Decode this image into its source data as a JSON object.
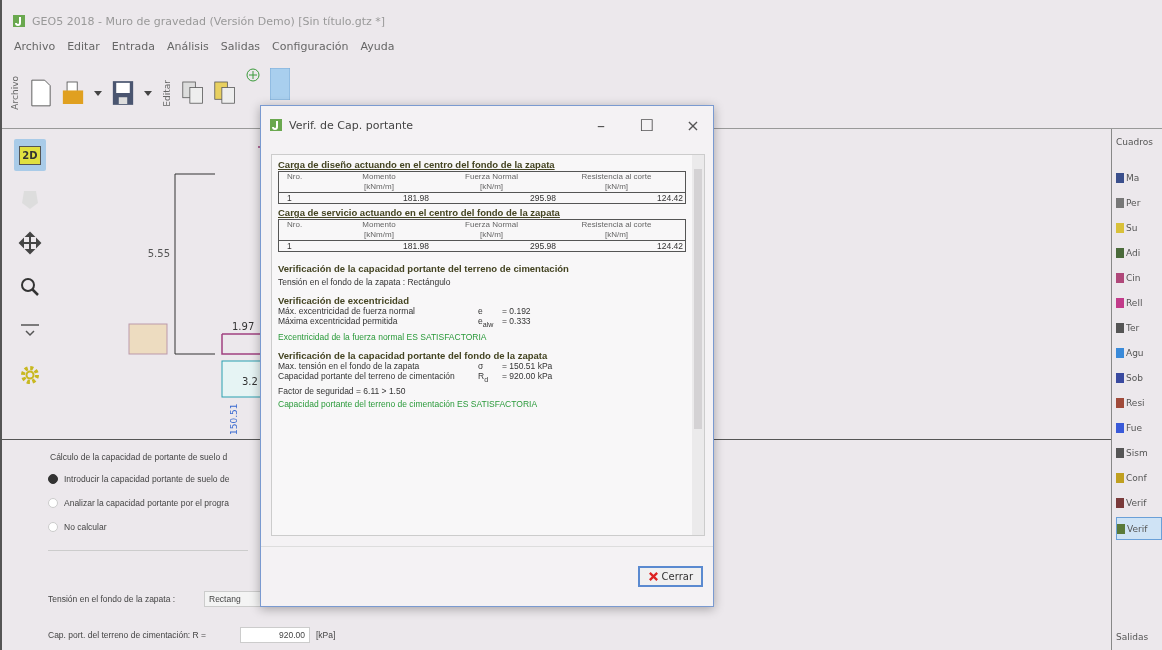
{
  "window": {
    "title": "GEO5 2018 - Muro de gravedad (Versión Demo) [Sin título.gtz *]"
  },
  "menu": [
    "Archivo",
    "Editar",
    "Entrada",
    "Análisis",
    "Salidas",
    "Configuración",
    "Ayuda"
  ],
  "toolbar": {
    "groups": [
      "Archivo",
      "Editar"
    ]
  },
  "side_tools": [
    {
      "kind": "badge",
      "label": "2D",
      "selected": true
    },
    {
      "kind": "shape",
      "selected": false
    },
    {
      "kind": "move",
      "selected": false
    },
    {
      "kind": "zoom",
      "selected": false
    },
    {
      "kind": "collapse",
      "selected": false
    },
    {
      "kind": "gear",
      "selected": false
    }
  ],
  "drawing": {
    "labels": [
      "5.55",
      "1.97",
      "3.2",
      "150.51"
    ]
  },
  "bottom_panel": {
    "group_label": "Cálculo de la capacidad de portante de suelo d",
    "options": [
      {
        "label": "Introducir la capacidad portante de suelo de",
        "selected": true
      },
      {
        "label": "Analizar la capacidad portante por el progra",
        "selected": false
      },
      {
        "label": "No calcular",
        "selected": false
      }
    ],
    "stress_label": "Tensión en el fondo de la zapata :",
    "stress_value": "Rectang",
    "capacity_label": "Cap. port. del terreno de cimentación:  R =",
    "capacity_value": "920.00",
    "capacity_unit": "[kPa]"
  },
  "right_panel": {
    "title": "Cuadros",
    "items": [
      {
        "label": "Ma",
        "kind": "table",
        "selected": false
      },
      {
        "label": "Per",
        "kind": "profile",
        "selected": false
      },
      {
        "label": "Su",
        "kind": "soil",
        "selected": false
      },
      {
        "label": "Adi",
        "kind": "assign",
        "selected": false
      },
      {
        "label": "Cin",
        "kind": "found",
        "selected": false
      },
      {
        "label": "Rell",
        "kind": "fill",
        "selected": false
      },
      {
        "label": "Ter",
        "kind": "terrain",
        "selected": false
      },
      {
        "label": "Agu",
        "kind": "water",
        "selected": false
      },
      {
        "label": "Sob",
        "kind": "surcharge",
        "selected": false
      },
      {
        "label": "Resi",
        "kind": "resist",
        "selected": false
      },
      {
        "label": "Fue",
        "kind": "force",
        "selected": false
      },
      {
        "label": "Sism",
        "kind": "earthquake",
        "selected": false
      },
      {
        "label": "Conf",
        "kind": "settings",
        "selected": false
      },
      {
        "label": "Verif",
        "kind": "verify",
        "selected": false
      },
      {
        "label": "Verif",
        "kind": "bearing",
        "selected": true
      }
    ],
    "footer": "Salidas"
  },
  "dialog": {
    "title": "Verif. de Cap. portante",
    "controls": [
      "–",
      "☐",
      "×"
    ],
    "sections": [
      {
        "kind": "table",
        "heading": "Carga de diseño actuando en el centro del fondo de la zapata",
        "columns": [
          {
            "name": "Nro."
          },
          {
            "name": "Momento",
            "unit": "[kNm/m]"
          },
          {
            "name": "Fuerza Normal",
            "unit": "[kN/m]"
          },
          {
            "name": "Resistencia al corte",
            "unit": "[kN/m]"
          }
        ],
        "rows": [
          [
            "1",
            "181.98",
            "295.98",
            "124.42"
          ]
        ]
      },
      {
        "kind": "table",
        "heading": "Carga de servicio actuando en el centro del fondo de la zapata",
        "columns": [
          {
            "name": "Nro."
          },
          {
            "name": "Momento",
            "unit": "[kNm/m]"
          },
          {
            "name": "Fuerza Normal",
            "unit": "[kN/m]"
          },
          {
            "name": "Resistencia al corte",
            "unit": "[kN/m]"
          }
        ],
        "rows": [
          [
            "1",
            "181.98",
            "295.98",
            "124.42"
          ]
        ]
      },
      {
        "kind": "text",
        "heading": "Verificación de la capacidad portante del terreno de cimentación",
        "lines": [
          {
            "kind": "plain",
            "text": "Tensión en el fondo de la zapata : Rectángulo"
          }
        ]
      },
      {
        "kind": "text",
        "heading": "Verificación de excentricidad",
        "lines": [
          {
            "kind": "row",
            "label": "Máx. excentricidad de fuerza normal",
            "symbol": "e",
            "value": "= 0.192"
          },
          {
            "kind": "row",
            "label": "Máxima excentricidad permitida",
            "symbol": "e$_{alw}$",
            "value": "= 0.333"
          },
          {
            "kind": "ok",
            "text": "Excentricidad de la fuerza normal ES SATISFACTORIA"
          }
        ]
      },
      {
        "kind": "text",
        "heading": "Verificación de la capacidad portante del fondo de la zapata",
        "lines": [
          {
            "kind": "row",
            "label": "Max. tensión en el fondo de la zapata",
            "symbol": "σ",
            "value": "= 150.51 kPa"
          },
          {
            "kind": "row",
            "label": "Capacidad portante del terreno de cimentación",
            "symbol": "R$_{d}$",
            "value": "= 920.00 kPa"
          },
          {
            "kind": "plain",
            "text": "Factor de seguridad = 6.11 > 1.50"
          },
          {
            "kind": "ok",
            "text": "Capacidad portante del terreno de cimentación ES SATISFACTORIA"
          }
        ]
      }
    ],
    "close_button": "Cerrar"
  }
}
